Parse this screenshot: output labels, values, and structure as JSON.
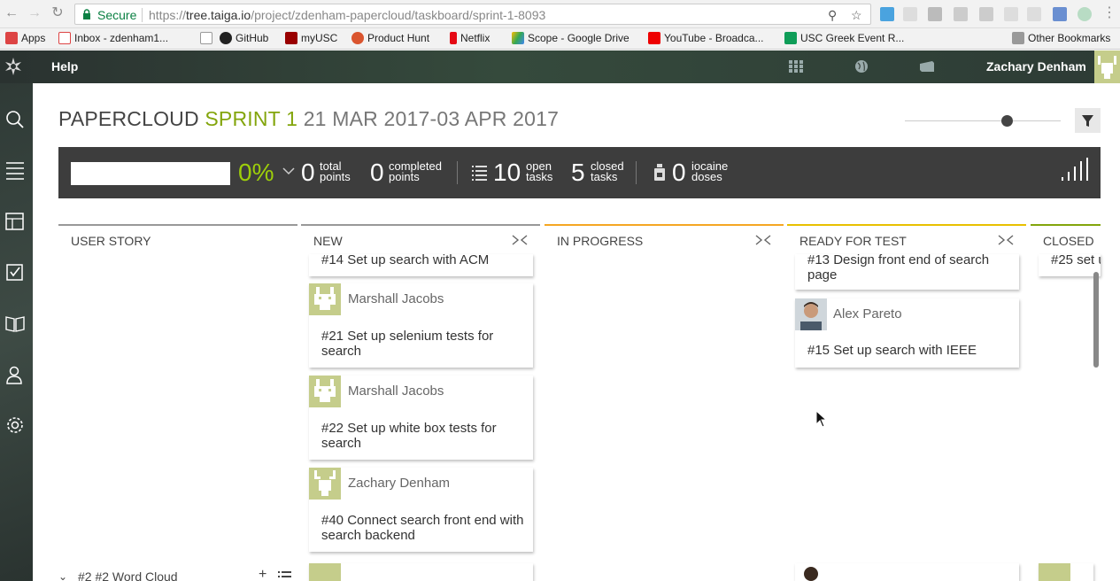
{
  "browser": {
    "secure_label": "Secure",
    "url_scheme": "https://",
    "url_host": "tree.taiga.io",
    "url_path": "/project/zdenham-papercloud/taskboard/sprint-1-8093",
    "bookmarks": [
      "Apps",
      "Inbox - zdenham1...",
      "GitHub",
      "myUSC",
      "Product Hunt",
      "Netflix",
      "Scope - Google Drive",
      "YouTube - Broadca...",
      "USC Greek Event R...",
      "Other Bookmarks"
    ]
  },
  "topbar": {
    "help": "Help",
    "user_name": "Zachary Denham"
  },
  "header": {
    "project": "PAPERCLOUD",
    "sprint": "SPRINT 1",
    "dates": "21 MAR 2017-03 APR 2017"
  },
  "summary": {
    "progress_pct": "0%",
    "progress_value": 0,
    "total_points": "0",
    "total_points_label_1": "total",
    "total_points_label_2": "points",
    "completed_points": "0",
    "completed_label_1": "completed",
    "completed_label_2": "points",
    "open_tasks": "10",
    "open_label_1": "open",
    "open_label_2": "tasks",
    "closed_tasks": "5",
    "closed_label_1": "closed",
    "closed_label_2": "tasks",
    "iocaine": "0",
    "iocaine_label_1": "iocaine",
    "iocaine_label_2": "doses"
  },
  "columns": {
    "user_story": "USER STORY",
    "new": "NEW",
    "in_progress": "IN PROGRESS",
    "ready_for_test": "READY FOR TEST",
    "closed": "CLOSED"
  },
  "cards": {
    "new_0_title": "#14 Set up search with ACM",
    "new_1_owner": "Marshall Jacobs",
    "new_1_title": "#21 Set up selenium tests for search",
    "new_2_owner": "Marshall Jacobs",
    "new_2_title": "#22 Set up white box tests for search",
    "new_3_owner": "Zachary Denham",
    "new_3_title": "#40 Connect search front end with search backend",
    "rft_0_title": "#13 Design front end of search page",
    "rft_1_owner": "Alex Pareto",
    "rft_1_title": "#15 Set up search with IEEE",
    "closed_0_title": "#25 set u"
  },
  "story_row": {
    "label": "#2 #2 Word Cloud"
  },
  "colors": {
    "accent_green": "#83a50c",
    "progress_green": "#9dce0a",
    "col_new": "#999999",
    "col_in_progress": "#f5a623",
    "col_ready": "#e8c000",
    "col_closed": "#83a50c"
  }
}
